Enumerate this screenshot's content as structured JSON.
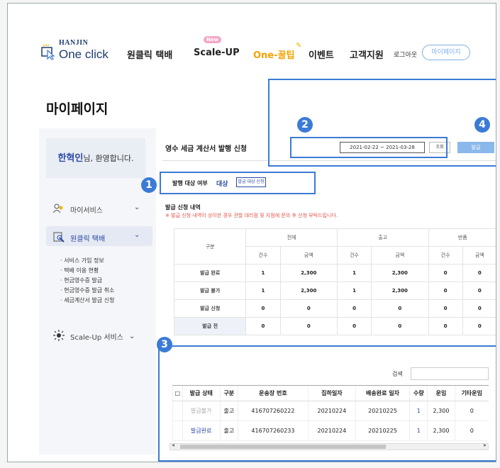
{
  "header": {
    "logo_brand": "HANJIN",
    "logo_product": "One click",
    "nav": [
      "원클릭 택배",
      "Scale-UP",
      "One-꿀팁",
      "이벤트",
      "고객지원"
    ],
    "new_badge": "New",
    "logout": "로그아웃",
    "mypage_button": "마이페이지"
  },
  "page_title": "마이페이지",
  "sidebar": {
    "welcome_name": "한혁인",
    "welcome_rest": "님, 환영합니다.",
    "menus": [
      "마이서비스",
      "원클릭 택배",
      "Scale-Up 서비스"
    ],
    "sub_items": [
      "서비스 가입 정보",
      "택배 이용 현황",
      "현금영수증 발급",
      "현금영수증 발급 취소",
      "세금계산서 발급 신청"
    ]
  },
  "content": {
    "section_title": "영수 세금 계산서 발행 신청",
    "date_range": "2021-02-22 ~ 2021-03-28",
    "search_button": "조회",
    "issue_button": "발급",
    "target_label": "발행 대상 여부",
    "target_value": "대상",
    "target_button": "발급 대상 신청",
    "history_title": "발급 신청 내역",
    "history_note": "※ 발급 신청 내역이 상이한 경우 관할 대리점 및 지점에 문의 후 신청 부탁드립니다.",
    "summary": {
      "corner": "구분",
      "groups": [
        "전체",
        "출고",
        "반품"
      ],
      "sub_headers": [
        "건수",
        "금액",
        "건수",
        "금액",
        "건수",
        "금액"
      ],
      "rows": [
        {
          "label": "발급 완료",
          "values": [
            "1",
            "2,300",
            "1",
            "2,300",
            "0",
            "0"
          ]
        },
        {
          "label": "발급 불가",
          "values": [
            "1",
            "2,300",
            "1",
            "2,300",
            "0",
            "0"
          ]
        },
        {
          "label": "발급 신청",
          "values": [
            "0",
            "0",
            "0",
            "0",
            "0",
            "0"
          ]
        },
        {
          "label": "발급 전",
          "values": [
            "0",
            "0",
            "0",
            "0",
            "0",
            "0"
          ]
        }
      ]
    },
    "list_search_label": "검색",
    "list": {
      "headers": [
        "□",
        "발급 상태",
        "구분",
        "운송장 번호",
        "집하일자",
        "배송완료 일자",
        "수량",
        "운임",
        "기타운임"
      ],
      "rows": [
        {
          "status": "발급불가",
          "type": "출고",
          "waybill": "416707260222",
          "pickup": "20210224",
          "delivered": "20210225",
          "qty": "1",
          "fare": "2,300",
          "other": "0"
        },
        {
          "status": "발급완료",
          "type": "출고",
          "waybill": "416707260233",
          "pickup": "20210224",
          "delivered": "20210225",
          "qty": "1",
          "fare": "2,300",
          "other": "0"
        }
      ]
    }
  },
  "markers": [
    "1",
    "2",
    "3",
    "4"
  ],
  "accent_color": "#3b7bd6"
}
